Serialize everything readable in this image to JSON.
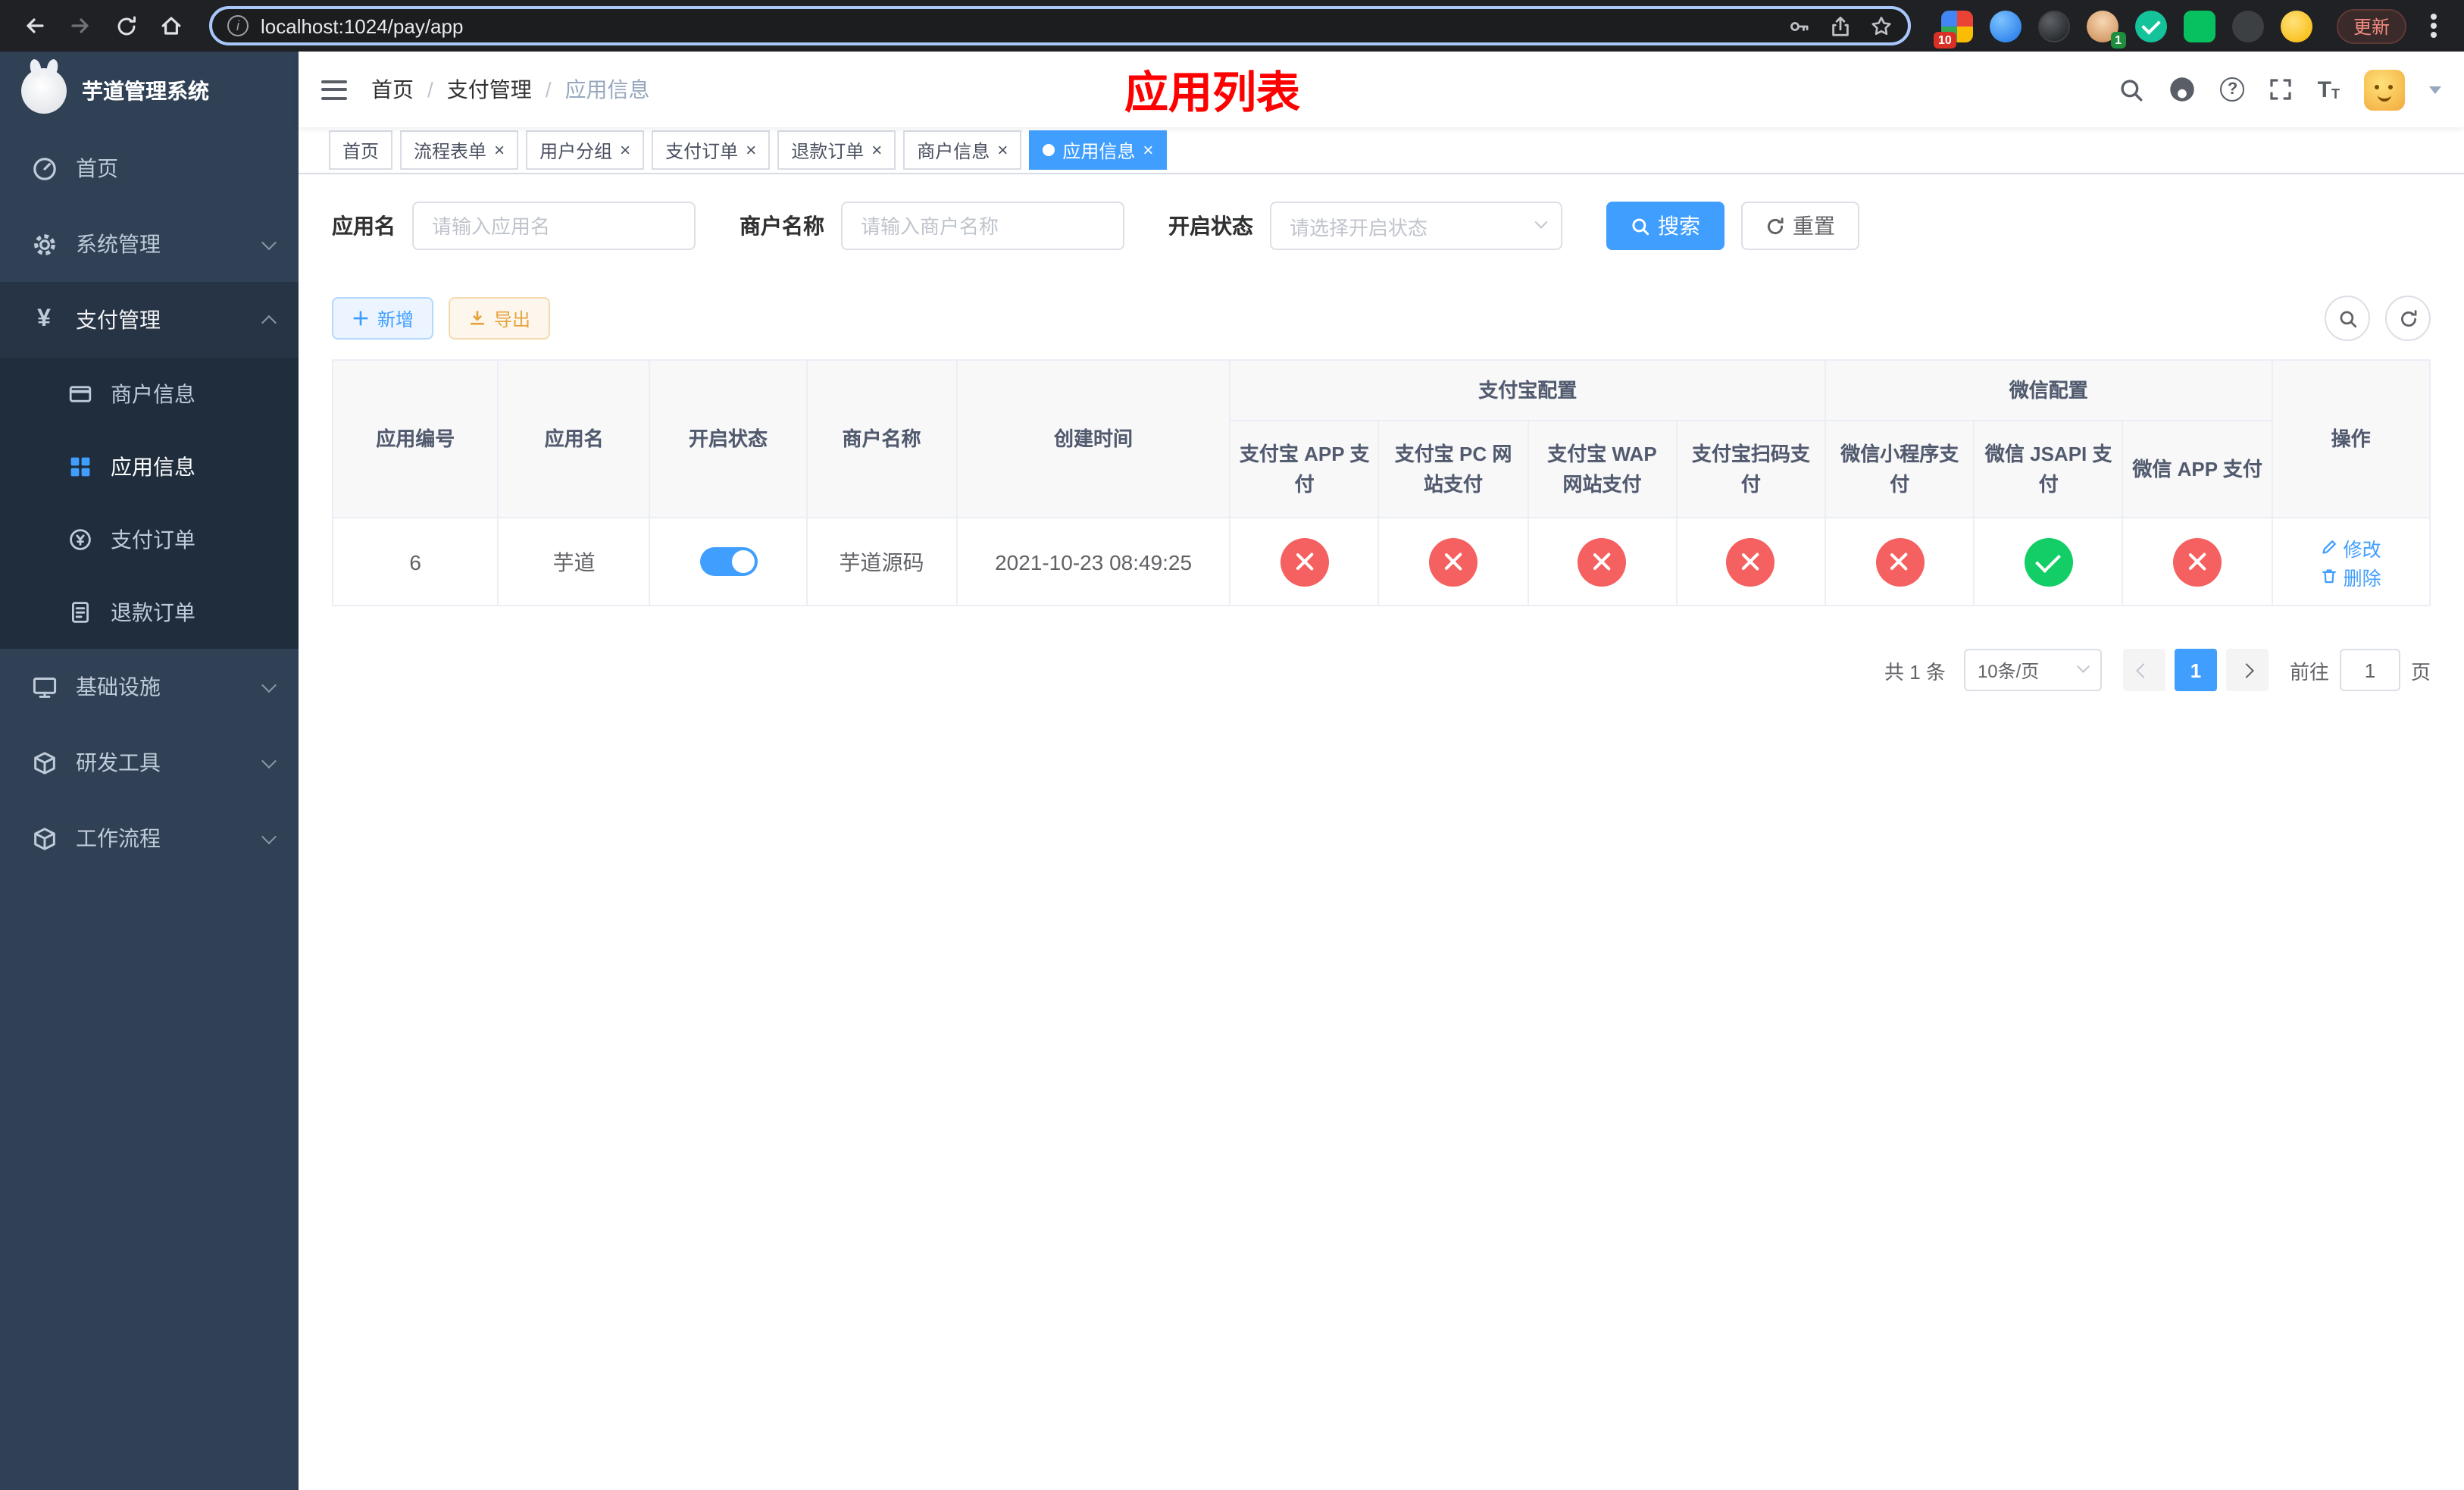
{
  "browser": {
    "url": "localhost:1024/pay/app",
    "update_label": "更新",
    "extensions_badge": "10",
    "profile_badge": "1"
  },
  "sidebar": {
    "title": "芋道管理系统",
    "items": [
      {
        "label": "首页"
      },
      {
        "label": "系统管理"
      },
      {
        "label": "支付管理"
      },
      {
        "label": "基础设施"
      },
      {
        "label": "研发工具"
      },
      {
        "label": "工作流程"
      }
    ],
    "payment_children": [
      {
        "label": "商户信息"
      },
      {
        "label": "应用信息",
        "state": "active"
      },
      {
        "label": "支付订单"
      },
      {
        "label": "退款订单"
      }
    ]
  },
  "header": {
    "breadcrumb": [
      "首页",
      "支付管理",
      "应用信息"
    ],
    "page_title": "应用列表"
  },
  "tabs": [
    {
      "label": "首页"
    },
    {
      "label": "流程表单"
    },
    {
      "label": "用户分组"
    },
    {
      "label": "支付订单"
    },
    {
      "label": "退款订单"
    },
    {
      "label": "商户信息"
    },
    {
      "label": "应用信息",
      "state": "active"
    }
  ],
  "filters": {
    "app_name_label": "应用名",
    "app_name_placeholder": "请输入应用名",
    "merchant_label": "商户名称",
    "merchant_placeholder": "请输入商户名称",
    "status_label": "开启状态",
    "status_placeholder": "请选择开启状态",
    "search_label": "搜索",
    "reset_label": "重置"
  },
  "toolbar": {
    "add_label": "新增",
    "export_label": "导出"
  },
  "table": {
    "headers": {
      "app_id": "应用编号",
      "app_name": "应用名",
      "status": "开启状态",
      "merchant": "商户名称",
      "create_time": "创建时间",
      "alipay_group": "支付宝配置",
      "alipay_app": "支付宝 APP 支付",
      "alipay_pc": "支付宝 PC 网站支付",
      "alipay_wap": "支付宝 WAP 网站支付",
      "alipay_qr": "支付宝扫码支付",
      "wechat_group": "微信配置",
      "wechat_mini": "微信小程序支付",
      "wechat_jsapi": "微信 JSAPI 支付",
      "wechat_app": "微信 APP 支付",
      "actions": "操作"
    },
    "rows": [
      {
        "app_id": "6",
        "app_name": "芋道",
        "status": "on",
        "merchant": "芋道源码",
        "create_time": "2021-10-23 08:49:25",
        "alipay_app": "disabled",
        "alipay_pc": "disabled",
        "alipay_wap": "disabled",
        "alipay_qr": "disabled",
        "wechat_mini": "disabled",
        "wechat_jsapi": "enabled",
        "wechat_app": "disabled",
        "edit_label": "修改",
        "delete_label": "删除"
      }
    ]
  },
  "pagination": {
    "total_text": "共 1 条",
    "page_size": "10条/页",
    "current_page": "1",
    "goto_label": "前往",
    "goto_value": "1",
    "goto_suffix": "页"
  },
  "colors": {
    "accent": "#409eff",
    "danger": "#f56060",
    "success": "#13ce66",
    "title_red": "#ff0000",
    "sidebar_bg": "#304156",
    "sidebar_sub_bg": "#1f2d3d"
  },
  "icon_names": [
    "back-icon",
    "forward-icon",
    "reload-icon",
    "home-icon",
    "site-info-icon",
    "key-icon",
    "share-icon",
    "bookmark-star-icon",
    "browser-menu-icon",
    "hamburger-icon",
    "search-icon",
    "github-icon",
    "help-icon",
    "fullscreen-icon",
    "font-size-icon",
    "caret-down-icon",
    "dashboard-icon",
    "gear-icon",
    "yen-icon",
    "credit-card-icon",
    "app-grid-icon",
    "coin-icon",
    "receipt-icon",
    "monitor-icon",
    "box-icon",
    "plus-icon",
    "download-icon",
    "edit-pencil-icon",
    "trash-icon",
    "check-icon",
    "cross-icon",
    "prev-arrow-icon",
    "next-arrow-icon"
  ]
}
